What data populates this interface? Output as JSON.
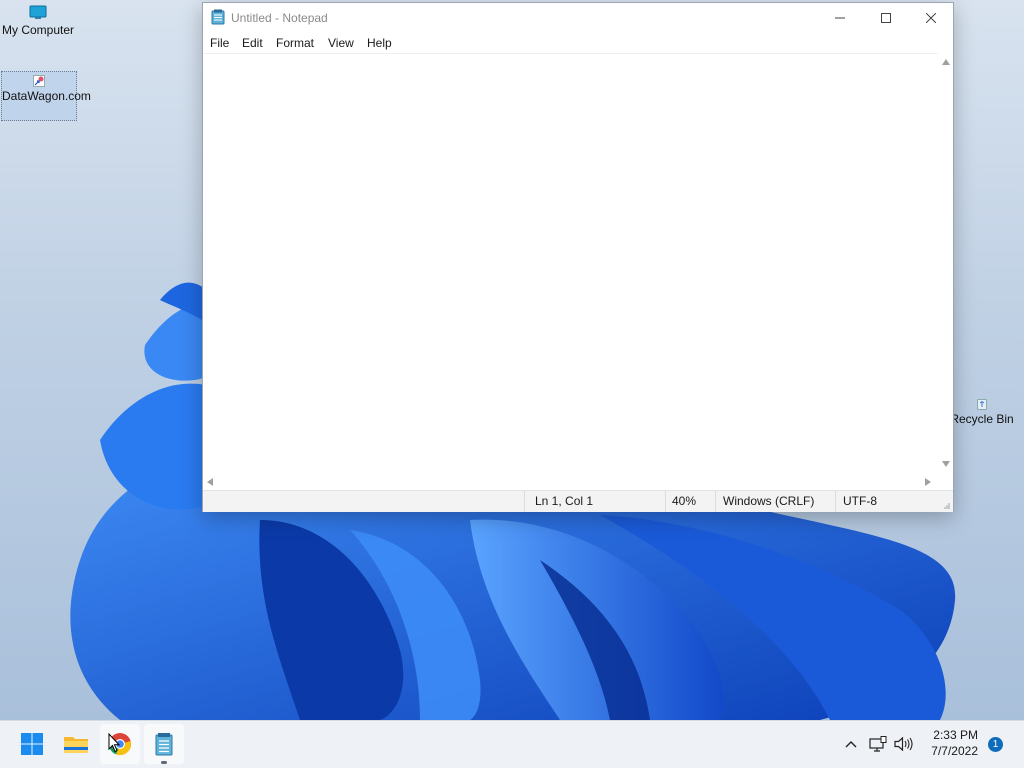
{
  "desktop": {
    "icons": [
      {
        "label": "My Computer",
        "icon": "monitor-icon"
      },
      {
        "label": "DataWagon.com",
        "icon": "shortcut-icon"
      },
      {
        "label": "Recycle Bin",
        "icon": "recycle-bin-icon"
      }
    ]
  },
  "notepad": {
    "title": "Untitled - Notepad",
    "app_icon": "notepad-icon",
    "menu": [
      "File",
      "Edit",
      "Format",
      "View",
      "Help"
    ],
    "content": "",
    "status": {
      "position": "Ln 1, Col 1",
      "zoom": "40%",
      "line_ending": "Windows (CRLF)",
      "encoding": "UTF-8"
    }
  },
  "taskbar": {
    "apps": [
      "windows-start-icon",
      "file-explorer-icon",
      "chrome-icon",
      "notepad-icon"
    ],
    "clock": {
      "time": "2:33 PM",
      "date": "7/7/2022"
    },
    "notification_count": "1"
  },
  "colors": {
    "accent": "#0f6cbd",
    "wallpaper_blue": "#1565e6",
    "taskbar_bg": "#eef1f5"
  }
}
